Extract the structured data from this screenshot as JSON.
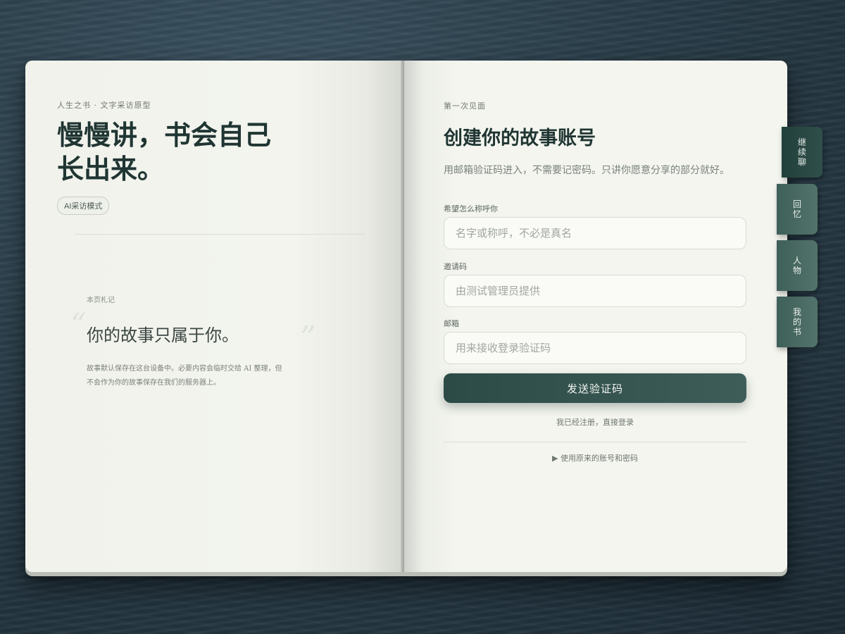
{
  "left_page": {
    "eyebrow": "人生之书 · 文字采访原型",
    "title": "慢慢讲，书会自己长出来。",
    "badge": "AI采访模式",
    "note": {
      "label": "本页札记",
      "quote": "你的故事只属于你。",
      "body": "故事默认保存在这台设备中。必要内容会临时交给 AI 整理，但不会作为你的故事保存在我们的服务器上。"
    }
  },
  "right_page": {
    "eyebrow": "第一次见面",
    "title": "创建你的故事账号",
    "description": "用邮箱验证码进入，不需要记密码。只讲你愿意分享的部分就好。",
    "fields": {
      "name": {
        "label": "希望怎么称呼你",
        "placeholder": "名字或称呼，不必是真名",
        "value": ""
      },
      "invite": {
        "label": "邀请码",
        "placeholder": "由测试管理员提供",
        "value": ""
      },
      "email": {
        "label": "邮箱",
        "placeholder": "用来接收登录验证码",
        "value": ""
      }
    },
    "submit_label": "发送验证码",
    "login_link": "我已经注册，直接登录",
    "password_link": "▶ 使用原来的账号和密码"
  },
  "tabs": [
    {
      "label": "继续聊",
      "active": true
    },
    {
      "label": "回忆",
      "active": false
    },
    {
      "label": "人物",
      "active": false
    },
    {
      "label": "我的书",
      "active": false
    }
  ],
  "colors": {
    "accent": "#2f4f4a",
    "paper": "#f3f4ee",
    "ink": "#1f3532"
  }
}
